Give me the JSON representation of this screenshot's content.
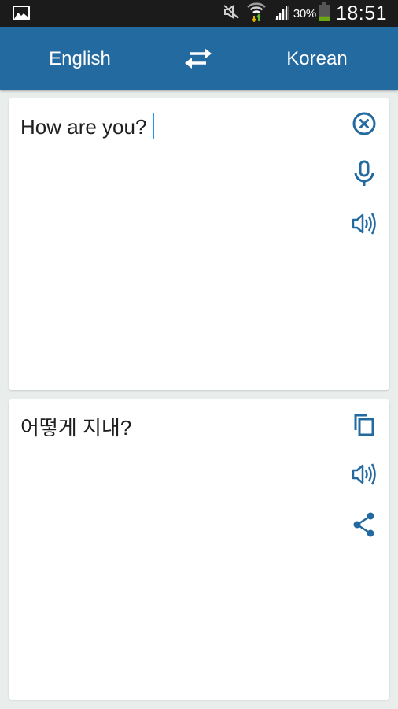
{
  "status_bar": {
    "left_icon": "gallery-icon",
    "icons": [
      "mute-icon",
      "wifi-icon",
      "signal-icon",
      "battery-icon"
    ],
    "battery_percent": "30%",
    "battery_level": 0.3,
    "time": "18:51"
  },
  "app_bar": {
    "source_language": "English",
    "target_language": "Korean",
    "swap_icon": "swap-arrows-icon"
  },
  "input_card": {
    "text": "How are you?",
    "actions": [
      {
        "name": "clear",
        "icon": "clear-circle-icon"
      },
      {
        "name": "voice-input",
        "icon": "microphone-icon"
      },
      {
        "name": "speak",
        "icon": "speaker-icon"
      }
    ]
  },
  "output_card": {
    "text": "어떻게 지내?",
    "actions": [
      {
        "name": "copy",
        "icon": "copy-icon"
      },
      {
        "name": "speak",
        "icon": "speaker-icon"
      },
      {
        "name": "share",
        "icon": "share-icon"
      }
    ]
  },
  "colors": {
    "primary": "#236aa0",
    "icon": "#236aa0",
    "caret": "#2196f3",
    "background": "#e9eeed",
    "battery_fill": "#6aa515"
  }
}
